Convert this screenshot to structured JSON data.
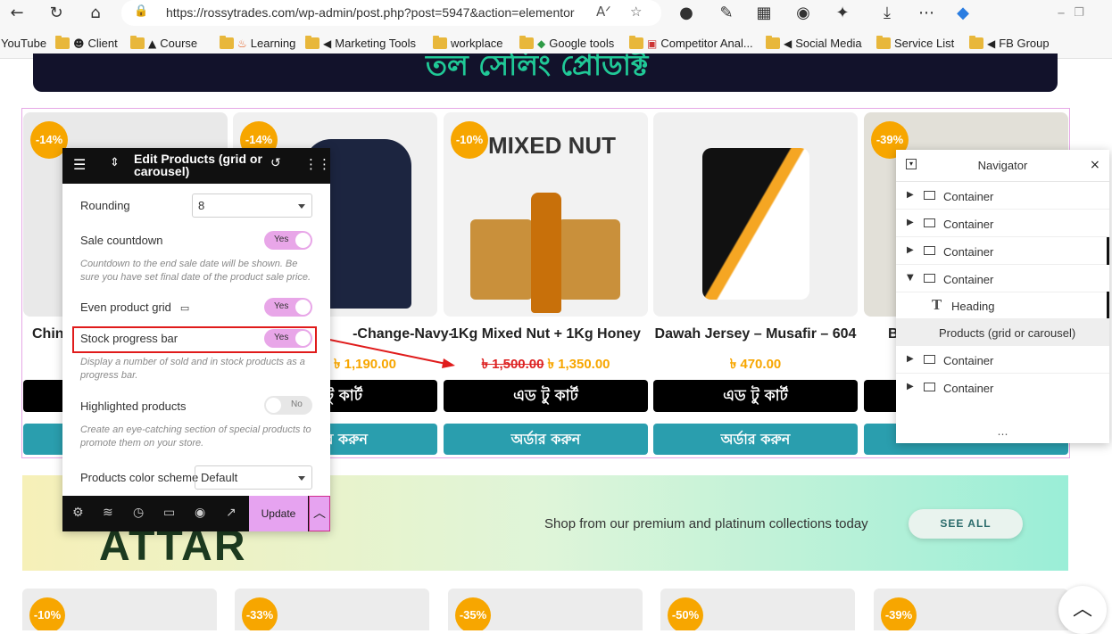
{
  "browser": {
    "url": "https://rossytrades.com/wp-admin/post.php?post=5947&action=elementor",
    "read_aloud_glyph": "Aᐟ",
    "bookmarks": [
      {
        "label": "YouTube",
        "icon": "none"
      },
      {
        "label": "Client",
        "icon": "person-icon"
      },
      {
        "label": "Course",
        "icon": "graduation-cap-icon"
      },
      {
        "label": "Learning",
        "icon": "fire-icon"
      },
      {
        "label": "Marketing Tools",
        "icon": "megaphone-icon"
      },
      {
        "label": "workplace",
        "icon": "folder-icon"
      },
      {
        "label": "Google tools",
        "icon": "shield-icon"
      },
      {
        "label": "Competitor Anal...",
        "icon": "chart-icon"
      },
      {
        "label": "Social Media",
        "icon": "megaphone-icon"
      },
      {
        "label": "Service List",
        "icon": "folder-icon"
      },
      {
        "label": "FB Group",
        "icon": "megaphone-icon"
      }
    ]
  },
  "page": {
    "banner_text": "তল সেলিং প্রোডাক্ট",
    "products": [
      {
        "badge": "-14%",
        "name": "Chin",
        "old_price": "",
        "price": "",
        "cart": "",
        "order": ""
      },
      {
        "badge": "-14%",
        "name": "-Change-Navy-",
        "old_price": "",
        "price": "৳ 1,190.00",
        "cart": "টু কার্ট",
        "order": "র করুন"
      },
      {
        "badge": "-10%",
        "name": "1Kg Mixed Nut + 1Kg Honey",
        "old_price": "৳ 1,500.00",
        "price": "৳ 1,350.00",
        "cart": "এড টু কার্ট",
        "order": "অর্ডার করুন"
      },
      {
        "badge": "",
        "name": "Dawah Jersey – Musafir – 604",
        "old_price": "",
        "price": "৳ 470.00",
        "cart": "এড টু কার্ট",
        "order": "অর্ডার করুন"
      },
      {
        "badge": "-39%",
        "name": "B",
        "old_price": "",
        "price": "",
        "cart": "",
        "order": ""
      }
    ],
    "promo": {
      "big_text": "ATTAR",
      "text": "Shop from our premium and platinum collections today",
      "button": "SEE ALL"
    },
    "bottom_badges": [
      "-10%",
      "-33%",
      "-35%",
      "-50%",
      "-39%"
    ]
  },
  "panel": {
    "title": "Edit Products (grid or carousel)",
    "rounding_label": "Rounding",
    "rounding_value": "8",
    "sale_countdown_label": "Sale countdown",
    "sale_countdown_value": "Yes",
    "sale_countdown_help": "Countdown to the end sale date will be shown. Be sure you have set final date of the product sale price.",
    "even_grid_label": "Even product grid",
    "even_grid_value": "Yes",
    "stock_bar_label": "Stock progress bar",
    "stock_bar_value": "Yes",
    "stock_bar_help": "Display a number of sold and in stock products as a progress bar.",
    "highlighted_label": "Highlighted products",
    "highlighted_value": "No",
    "highlighted_help": "Create an eye-catching section of special products to promote them on your store.",
    "color_scheme_label": "Products color scheme",
    "color_scheme_value": "Default",
    "update_label": "Update"
  },
  "navigator": {
    "title": "Navigator",
    "items": [
      {
        "label": "Container",
        "type": "container",
        "expanded": false
      },
      {
        "label": "Container",
        "type": "container",
        "expanded": false
      },
      {
        "label": "Container",
        "type": "container",
        "expanded": false
      },
      {
        "label": "Container",
        "type": "container",
        "expanded": true
      },
      {
        "label": "Heading",
        "type": "heading",
        "expanded": false
      },
      {
        "label": "Products (grid or carousel)",
        "type": "widget",
        "expanded": false,
        "active": true
      },
      {
        "label": "Container",
        "type": "container",
        "expanded": false
      },
      {
        "label": "Container",
        "type": "container",
        "expanded": false
      }
    ]
  },
  "colors": {
    "accent": "#e6a3f0",
    "badge": "#f7a600",
    "order_button": "#2a9eae",
    "banner_text": "#20c997"
  }
}
